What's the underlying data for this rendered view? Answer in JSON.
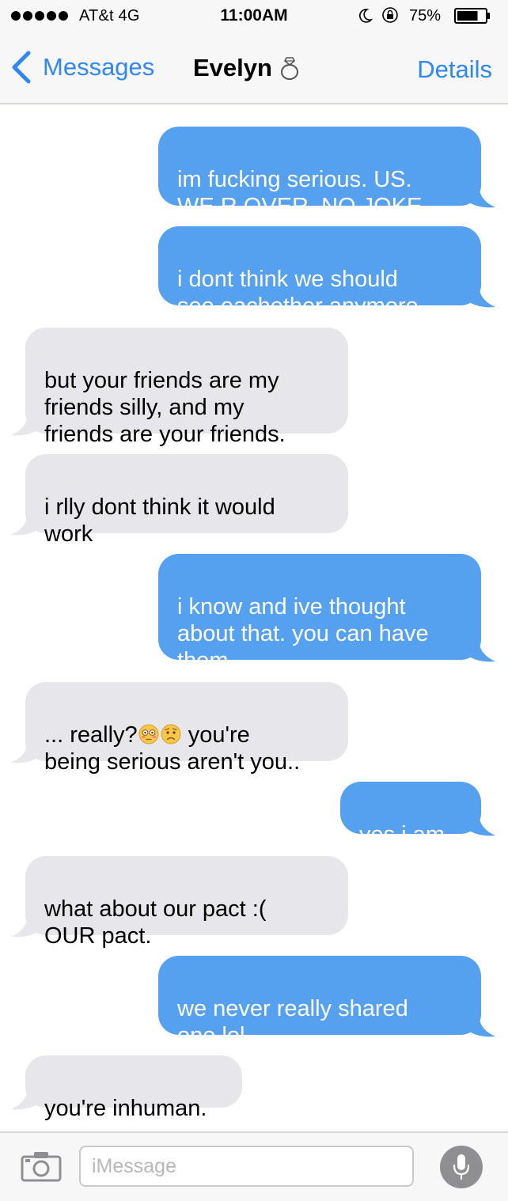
{
  "status_bar": {
    "carrier": "AT&t  4G",
    "time": "11:00AM",
    "battery": "75%",
    "battery_level": 0.75
  },
  "nav": {
    "back_label": "Messages",
    "contact_name": "Evelyn",
    "details_label": "Details"
  },
  "colors": {
    "accent": "#2f87f5",
    "sent_bubble": "#56a0f0",
    "received_bubble": "#e6e6eb"
  },
  "messages": [
    {
      "direction": "sent",
      "text": "im fucking serious. US.\nWE R OVER. NO JOKE"
    },
    {
      "direction": "sent",
      "text": "i dont think we should\nsee eachother anymore"
    },
    {
      "direction": "received",
      "text": "but your friends are my\nfriends silly, and my\nfriends are your friends."
    },
    {
      "direction": "received",
      "text": "i rlly dont think it would\nwork"
    },
    {
      "direction": "sent",
      "text": "i know and ive thought\nabout that. you can have\nthem."
    },
    {
      "direction": "received",
      "text_before_emoji": "... really?",
      "emoji": [
        "flushed-face-emoji",
        "worried-face-emoji"
      ],
      "text_after_emoji": " you're\nbeing serious aren't you.."
    },
    {
      "direction": "sent",
      "text": "yes i am."
    },
    {
      "direction": "received",
      "text": "what about our pact :(\nOUR pact."
    },
    {
      "direction": "sent",
      "text": "we never really shared\none lol"
    },
    {
      "direction": "received",
      "text": "you're inhuman."
    }
  ],
  "input": {
    "placeholder": "iMessage",
    "camera_icon": "camera-icon",
    "mic_icon": "microphone-icon"
  }
}
